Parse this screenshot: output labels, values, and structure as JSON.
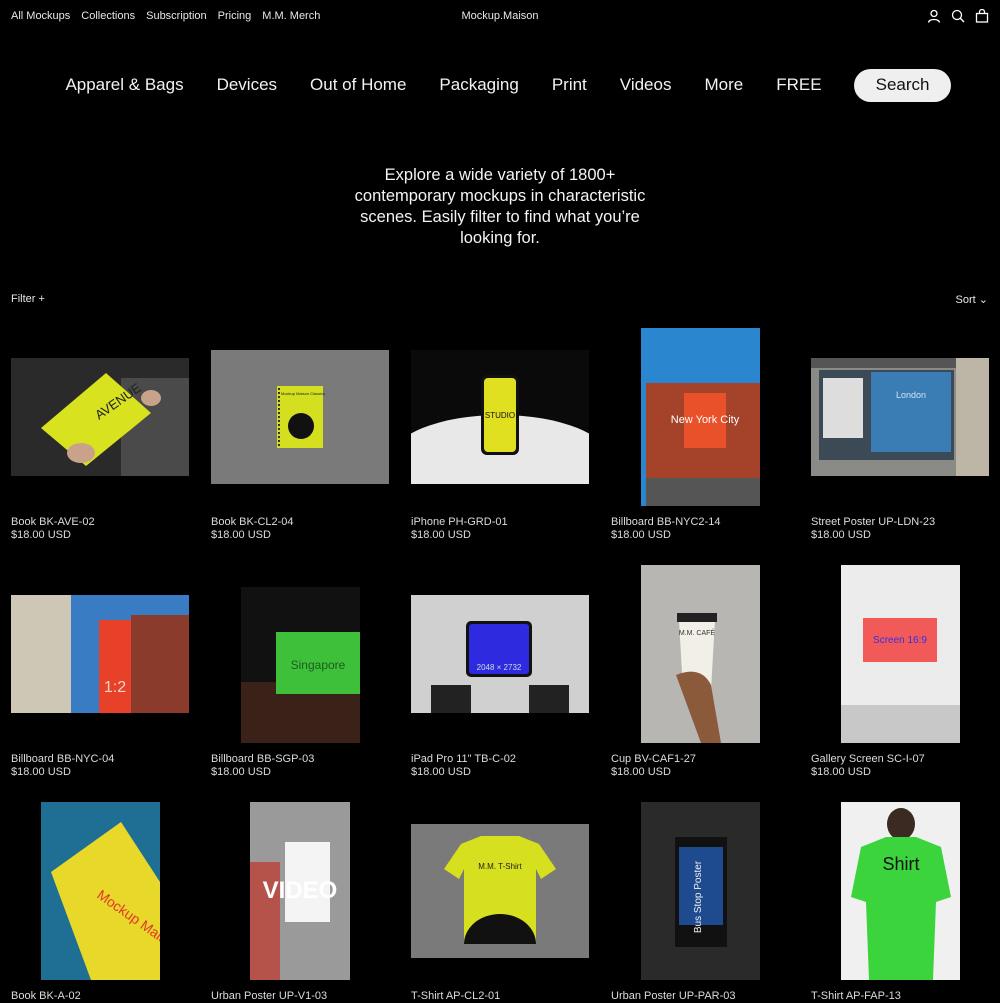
{
  "top_nav": {
    "links": [
      "All Mockups",
      "Collections",
      "Subscription",
      "Pricing",
      "M.M. Merch"
    ],
    "brand": "Mockup.Maison",
    "icons": [
      "account-icon",
      "search-icon",
      "cart-icon"
    ]
  },
  "categories": [
    "Apparel & Bags",
    "Devices",
    "Out of Home",
    "Packaging",
    "Print",
    "Videos",
    "More",
    "FREE"
  ],
  "search_label": "Search",
  "intro": "Explore a wide variety of 1800+ contemporary mockups in characteristic scenes. Easily filter to find what you’re looking for.",
  "toolbar": {
    "filter": "Filter +",
    "sort": "Sort ⌄"
  },
  "products": [
    {
      "name": "Book BK-AVE-02",
      "price": "$18.00 USD",
      "thumb_text": "AVENUE"
    },
    {
      "name": "Book BK-CL2-04",
      "price": "$18.00 USD",
      "thumb_text": "Mockup Maison Classics"
    },
    {
      "name": "iPhone PH-GRD-01",
      "price": "$18.00 USD",
      "thumb_text": "STUDIO"
    },
    {
      "name": "Billboard BB-NYC2-14",
      "price": "$18.00 USD",
      "thumb_text": "New York City"
    },
    {
      "name": "Street Poster UP-LDN-23",
      "price": "$18.00 USD",
      "thumb_text": "London"
    },
    {
      "name": "Billboard BB-NYC-04",
      "price": "$18.00 USD",
      "thumb_text": "1:2"
    },
    {
      "name": "Billboard BB-SGP-03",
      "price": "$18.00 USD",
      "thumb_text": "Singapore"
    },
    {
      "name": "iPad Pro 11\" TB-C-02",
      "price": "$18.00 USD",
      "thumb_text": "2048 × 2732"
    },
    {
      "name": "Cup BV-CAF1-27",
      "price": "$18.00 USD",
      "thumb_text": "M.M. CAFÉ"
    },
    {
      "name": "Gallery Screen SC-I-07",
      "price": "$18.00 USD",
      "thumb_text": "Screen 16:9"
    },
    {
      "name": "Book BK-A-02",
      "price": "",
      "thumb_text": "Mockup Maison Soft"
    },
    {
      "name": "Urban Poster UP-V1-03",
      "price": "",
      "thumb_text": "VIDEO"
    },
    {
      "name": "T-Shirt AP-CL2-01",
      "price": "",
      "thumb_text": "M.M. T-Shirt"
    },
    {
      "name": "Urban Poster UP-PAR-03",
      "price": "",
      "thumb_text": "Bus Stop Poster"
    },
    {
      "name": "T-Shirt AP-FAP-13",
      "price": "",
      "thumb_text": "Shirt"
    }
  ]
}
